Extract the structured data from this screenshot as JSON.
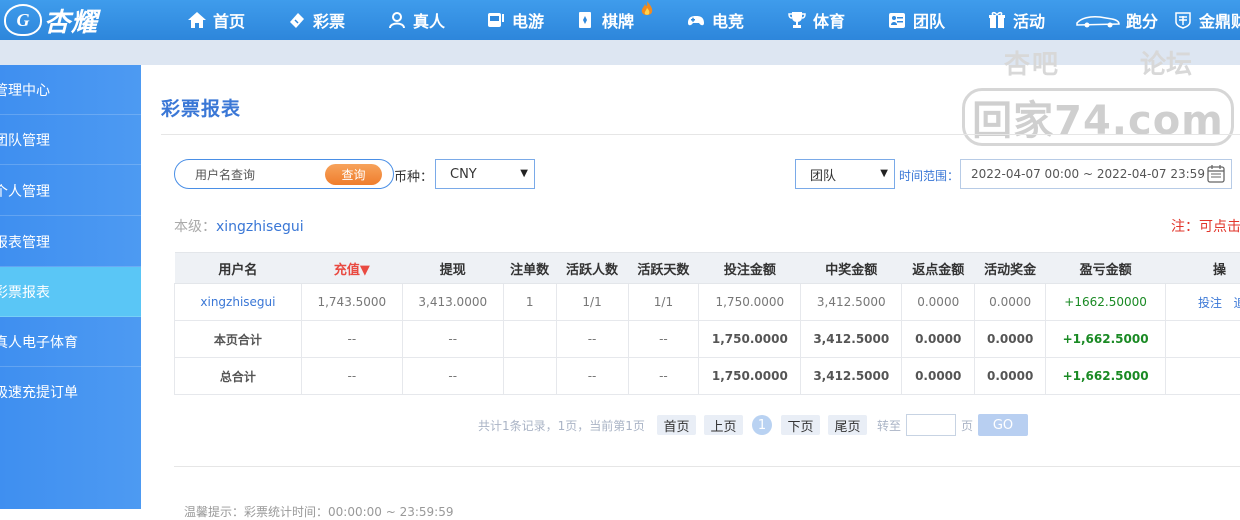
{
  "logo": {
    "text": "杏耀",
    "badge": "G"
  },
  "nav": [
    {
      "label": "首页",
      "icon": "home-icon"
    },
    {
      "label": "彩票",
      "icon": "ticket-icon"
    },
    {
      "label": "真人",
      "icon": "dealer-icon"
    },
    {
      "label": "电游",
      "icon": "slot-icon"
    },
    {
      "label": "棋牌",
      "icon": "card-icon"
    },
    {
      "label": "电竞",
      "icon": "gamepad-icon"
    },
    {
      "label": "体育",
      "icon": "trophy-icon"
    },
    {
      "label": "团队",
      "icon": "team-icon"
    },
    {
      "label": "活动",
      "icon": "gift-icon"
    },
    {
      "label": "跑分",
      "icon": "car-icon"
    },
    {
      "label": "金鼎财",
      "icon": "emblem-icon"
    }
  ],
  "sidebar": [
    {
      "label": "管理中心"
    },
    {
      "label": "团队管理"
    },
    {
      "label": "个人管理"
    },
    {
      "label": "报表管理"
    },
    {
      "label": "彩票报表",
      "active": true
    },
    {
      "label": "真人电子体育"
    },
    {
      "label": "极速充提订单"
    }
  ],
  "page_title": "彩票报表",
  "search": {
    "placeholder": "用户名查询",
    "button": "查询"
  },
  "currency": {
    "label": "币种：",
    "value": "CNY"
  },
  "scope": {
    "value": "团队"
  },
  "time_range": {
    "label": "时间范围：",
    "value": "2022-04-07 00:00 ~ 2022-04-07 23:59"
  },
  "level": {
    "label": "本级：",
    "value": "xingzhisegui"
  },
  "note": "注：可点击",
  "table": {
    "headers": [
      "用户名",
      "充值▼",
      "提现",
      "注单数",
      "活跃人数",
      "活跃天数",
      "投注金额",
      "中奖金额",
      "返点金额",
      "活动奖金",
      "盈亏金额",
      "操"
    ],
    "row": {
      "user": "xingzhisegui",
      "recharge": "1,743.5000",
      "withdraw": "3,413.0000",
      "orders": "1",
      "active_users": "1/1",
      "active_days": "1/1",
      "bet": "1,750.0000",
      "win": "3,412.5000",
      "rebate": "0.0000",
      "bonus": "0.0000",
      "profit": "+1662.50000",
      "actions": "投注",
      "actions2": "追"
    },
    "page_total": {
      "label": "本页合计",
      "recharge": "--",
      "withdraw": "--",
      "orders": "",
      "active_users": "--",
      "active_days": "--",
      "bet": "1,750.0000",
      "win": "3,412.5000",
      "rebate": "0.0000",
      "bonus": "0.0000",
      "profit": "+1,662.5000"
    },
    "grand_total": {
      "label": "总合计",
      "recharge": "--",
      "withdraw": "--",
      "orders": "",
      "active_users": "--",
      "active_days": "--",
      "bet": "1,750.0000",
      "win": "3,412.5000",
      "rebate": "0.0000",
      "bonus": "0.0000",
      "profit": "+1,662.5000"
    }
  },
  "pagination": {
    "summary": "共计1条记录，1页，当前第1页",
    "first": "首页",
    "prev": "上页",
    "current": "1",
    "next": "下页",
    "last": "尾页",
    "jump_label": "转至",
    "page_unit": "页",
    "go": "GO"
  },
  "tip": "温馨提示：彩票统计时间：00:00:00 ~ 23:59:59",
  "watermark": {
    "top_left": "杏吧",
    "top_right": "论坛",
    "site": "回家74.com"
  }
}
